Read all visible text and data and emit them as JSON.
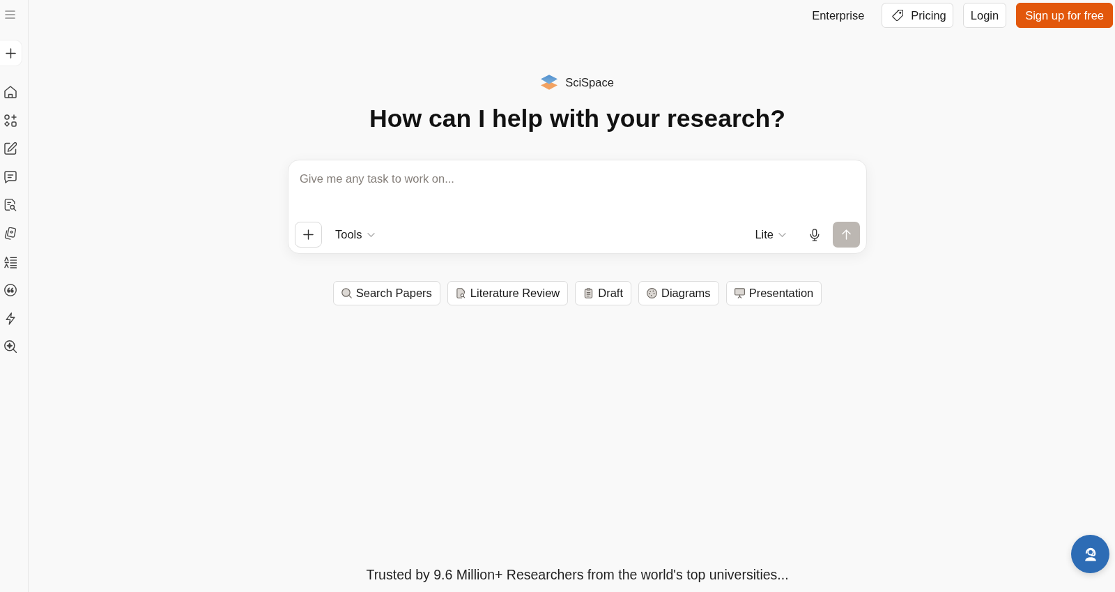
{
  "top_nav": {
    "items": [
      {
        "label": "Enterprise",
        "kind": "link"
      },
      {
        "label": "Pricing",
        "kind": "outline_tag"
      },
      {
        "label": "Login",
        "kind": "outline"
      },
      {
        "label": "Sign up for free",
        "kind": "primary"
      }
    ]
  },
  "brand": {
    "name": "SciSpace"
  },
  "heading": "How can I help with your research?",
  "prompt": {
    "placeholder": "Give me any task to work on...",
    "tools_menu": "Tools",
    "mode_menu": "Lite",
    "send_button": {
      "disabled": true
    }
  },
  "quick_actions": [
    "Search Papers",
    "Literature Review",
    "Draft",
    "Diagrams",
    "Presentation"
  ],
  "footer_text": "Trusted by 9.6 Million+ Researchers from the world's top universities..."
}
